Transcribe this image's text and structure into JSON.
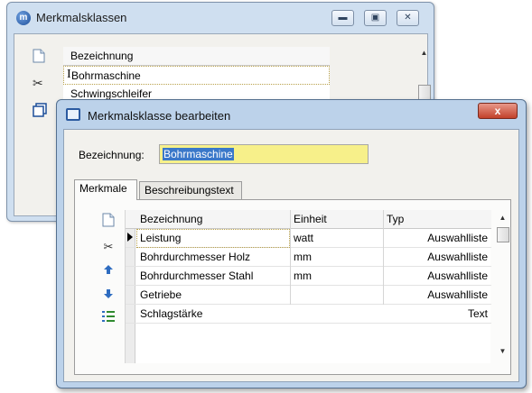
{
  "back_window": {
    "title": "Merkmalsklassen",
    "app_icon_glyph": "m",
    "header": "Bezeichnung",
    "rows": [
      "Bohrmaschine",
      "Schwingschleifer"
    ]
  },
  "dialog": {
    "title": "Merkmalsklasse bearbeiten",
    "close_glyph": "x",
    "field_label": "Bezeichnung:",
    "field_value": "Bohrmaschine",
    "tabs": [
      "Merkmale",
      "Beschreibungstext"
    ],
    "columns": [
      "Bezeichnung",
      "Einheit",
      "Typ"
    ],
    "rows": [
      {
        "bezeichnung": "Leistung",
        "einheit": "watt",
        "typ": "Auswahlliste"
      },
      {
        "bezeichnung": "Bohrdurchmesser Holz",
        "einheit": "mm",
        "typ": "Auswahlliste"
      },
      {
        "bezeichnung": "Bohrdurchmesser Stahl",
        "einheit": "mm",
        "typ": "Auswahlliste"
      },
      {
        "bezeichnung": "Getriebe",
        "einheit": "",
        "typ": "Auswahlliste"
      },
      {
        "bezeichnung": "Schlagstärke",
        "einheit": "",
        "typ": "Text"
      }
    ]
  },
  "colors": {
    "title_bar": "#bcd2ea",
    "client_bg": "#f2f1ed",
    "input_highlight": "#f7f08a",
    "selection_blue": "#3a78c9",
    "close_red": "#c2412a",
    "icon_blue": "#1d4f9a"
  },
  "icons": {
    "new": "new-document-icon",
    "cut": "scissors-icon",
    "copy": "copy-icon",
    "up": "arrow-up-icon",
    "down": "arrow-down-icon",
    "list": "numbered-list-icon"
  }
}
